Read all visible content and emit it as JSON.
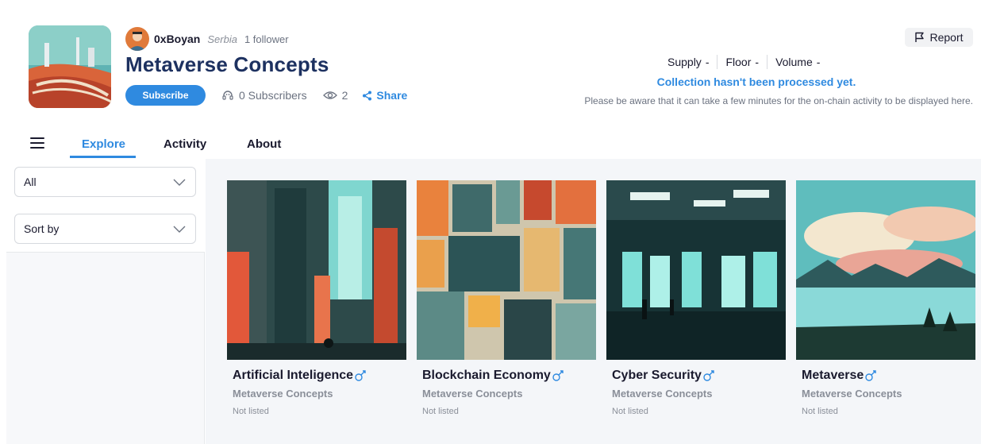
{
  "owner": {
    "name": "0xBoyan",
    "country": "Serbia",
    "followers": "1 follower"
  },
  "collection": {
    "title": "Metaverse Concepts"
  },
  "actions": {
    "subscribe_label": "Subscribe",
    "subscribers": "0 Subscribers",
    "views": "2",
    "share_label": "Share",
    "report_label": "Report"
  },
  "stats": {
    "supply_label": "Supply",
    "supply_value": "-",
    "floor_label": "Floor",
    "floor_value": "-",
    "volume_label": "Volume",
    "volume_value": "-",
    "processing": "Collection hasn't been processed yet.",
    "notice": "Please be aware that it can take a few minutes for the on-chain activity to be displayed here."
  },
  "tabs": [
    "Explore",
    "Activity",
    "About"
  ],
  "filters": {
    "category": "All",
    "sort": "Sort by"
  },
  "cards": [
    {
      "name": "Artificial Inteligence",
      "collection": "Metaverse Concepts",
      "status": "Not listed"
    },
    {
      "name": "Blockchain Economy",
      "collection": "Metaverse Concepts",
      "status": "Not listed"
    },
    {
      "name": "Cyber Security",
      "collection": "Metaverse Concepts",
      "status": "Not listed"
    },
    {
      "name": "Metaverse",
      "collection": "Metaverse Concepts",
      "status": "Not listed"
    }
  ],
  "icons": {
    "menu": "hamburger-icon",
    "subscribers": "headset-icon",
    "views": "eye-icon",
    "share": "share-icon",
    "report": "flag-icon",
    "dropdown": "chevron-down-icon",
    "card_link": "link-icon"
  },
  "colors": {
    "accent": "#2f8ae0",
    "title": "#1d3160",
    "muted": "#8a8f99"
  }
}
